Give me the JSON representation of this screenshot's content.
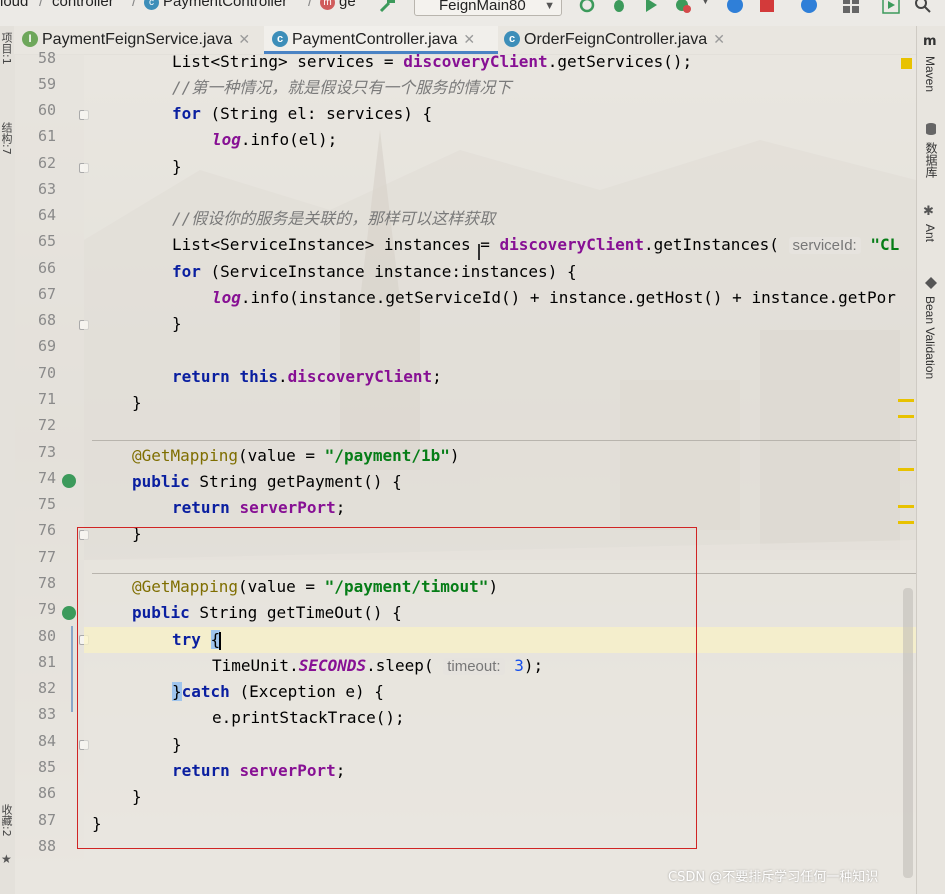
{
  "breadcrumb": [
    "loud",
    "controller",
    "PaymentController",
    "ge"
  ],
  "run_config": "FeignMain80",
  "tabs": [
    {
      "label": "PaymentFeignService.java",
      "icon": "I",
      "active": false
    },
    {
      "label": "PaymentController.java",
      "icon": "c",
      "active": true
    },
    {
      "label": "OrderFeignController.java",
      "icon": "c",
      "active": false
    }
  ],
  "left_tools": [
    "项目:1",
    "结构:7",
    "收藏:2"
  ],
  "right_tools": [
    "Maven",
    "数据库",
    "Ant",
    "Bean Validation"
  ],
  "line_numbers": [
    "58",
    "59",
    "60",
    "61",
    "62",
    "63",
    "64",
    "65",
    "66",
    "67",
    "68",
    "69",
    "70",
    "71",
    "72",
    "73",
    "74",
    "75",
    "76",
    "77",
    "78",
    "79",
    "80",
    "81",
    "82",
    "83",
    "84",
    "85",
    "86",
    "87",
    "88"
  ],
  "code": {
    "l58": {
      "a": "List<String> services = ",
      "b": "discoveryClient",
      "c": ".getServices();"
    },
    "l59": "//第一种情况，就是假设只有一个服务的情况下",
    "l60": {
      "kw": "for",
      "rest": " (String el: services) {"
    },
    "l61": {
      "a": "log",
      "b": ".info(el);"
    },
    "l62": "}",
    "l64": "//假设你的服务是关联的，那样可以这样获取",
    "l65": {
      "a": "List<ServiceInstance> instances = ",
      "b": "discoveryClient",
      "c": ".getInstances( ",
      "hint": "serviceId:",
      "d": " \"CL"
    },
    "l66": {
      "kw": "for",
      "rest": " (ServiceInstance instance:instances) {"
    },
    "l67": {
      "a": "log",
      "b": ".info(instance.getServiceId() + instance.getHost() + instance.getPor"
    },
    "l68": "}",
    "l70": {
      "kw": "return",
      "kw2": "this",
      "a": ".",
      "b": "discoveryClient",
      "c": ";"
    },
    "l71": "}",
    "l73": {
      "ann": "@GetMapping",
      "a": "(value = ",
      "str": "\"/payment/1b\"",
      "b": ")"
    },
    "l74": {
      "kw": "public",
      "rest": " String getPayment() {"
    },
    "l75": {
      "kw": "return",
      "fld": "serverPort",
      "b": ";"
    },
    "l76": "}",
    "l78": {
      "ann": "@GetMapping",
      "a": "(value = ",
      "str": "\"/payment/timout\"",
      "b": ")"
    },
    "l79": {
      "kw": "public",
      "rest": " String getTimeOut() {"
    },
    "l80": {
      "kw": "try",
      "brace": "{"
    },
    "l81": {
      "a": "TimeUnit.",
      "it": "SECONDS",
      "b": ".sleep( ",
      "hint": "timeout:",
      "num": "3",
      "c": ");"
    },
    "l82": {
      "brace": "}",
      "kw": "catch",
      "rest": " (Exception e) {"
    },
    "l83": "e.printStackTrace();",
    "l84": "}",
    "l85": {
      "kw": "return",
      "fld": "serverPort",
      "b": ";"
    },
    "l86": "}",
    "l87": "}"
  },
  "watermark": "CSDN @不要排斥学习任何一种知识",
  "colors": {
    "keyword": "#0a1fa0",
    "field": "#871094",
    "string": "#067d17",
    "annotation": "#7f6e00",
    "number": "#1750eb",
    "highlight_box": "#d02424"
  }
}
